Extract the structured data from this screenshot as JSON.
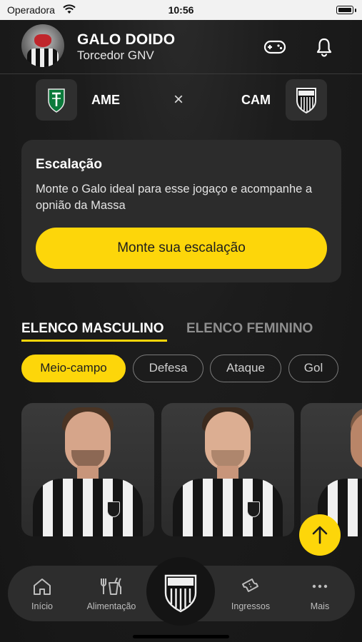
{
  "status_bar": {
    "carrier": "Operadora",
    "time": "10:56",
    "icons": [
      "wifi-icon",
      "battery-icon"
    ]
  },
  "header": {
    "user_name": "GALO DOIDO",
    "user_subtitle": "Torcedor GNV",
    "icons": [
      "gamepad-icon",
      "bell-icon"
    ]
  },
  "match": {
    "home_code": "AME",
    "away_code": "CAM",
    "separator": "×"
  },
  "lineup_card": {
    "title": "Escalação",
    "description": "Monte o Galo ideal para esse jogaço e acompanhe a opnião da Massa",
    "button_label": "Monte sua escalação"
  },
  "squad_tabs": [
    {
      "label": "ELENCO MASCULINO",
      "active": true
    },
    {
      "label": "ELENCO FEMININO",
      "active": false
    }
  ],
  "position_filters": [
    {
      "label": "Meio-campo",
      "active": true
    },
    {
      "label": "Defesa",
      "active": false
    },
    {
      "label": "Ataque",
      "active": false
    },
    {
      "label": "Gol",
      "active": false
    }
  ],
  "players_visible": 3,
  "bottom_nav": [
    {
      "label": "Início",
      "icon": "home-icon"
    },
    {
      "label": "Alimentação",
      "icon": "food-icon"
    },
    {
      "label": "",
      "icon": "club-crest-icon"
    },
    {
      "label": "Ingressos",
      "icon": "ticket-icon"
    },
    {
      "label": "Mais",
      "icon": "more-icon"
    }
  ],
  "colors": {
    "accent": "#fdd60a",
    "background": "#1b1b1b",
    "card": "#2c2c2c",
    "ame_green": "#0b7a3b"
  }
}
